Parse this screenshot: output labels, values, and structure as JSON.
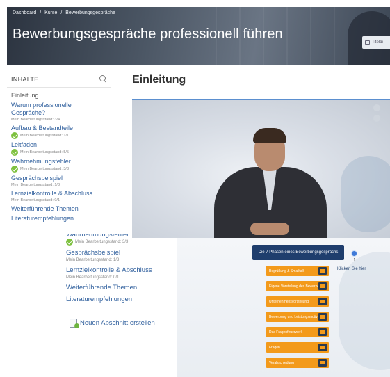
{
  "header": {
    "breadcrumb": [
      "Dashboard",
      "/",
      "Kurse",
      "/",
      "Bewerbungsgespräche"
    ],
    "title": "Bewerbungsgespräche professionell führen",
    "title_chip": "Titelbi"
  },
  "sidebar": {
    "heading": "INHALTE",
    "items": [
      {
        "title": "Einleitung",
        "status": "",
        "done": false
      },
      {
        "title": "Warum professionelle Gespräche?",
        "status": "Mein Bearbeitungsstand: 3/4",
        "done": false
      },
      {
        "title": "Aufbau & Bestandteile",
        "status": "Mein Bearbeitungsstand: 1/1",
        "done": true
      },
      {
        "title": "Leitfaden",
        "status": "Mein Bearbeitungsstand: 5/5",
        "done": true
      },
      {
        "title": "Wahrnehmungsfehler",
        "status": "Mein Bearbeitungsstand: 3/3",
        "done": true
      },
      {
        "title": "Gesprächsbeispiel",
        "status": "Mein Bearbeitungsstand: 1/3",
        "done": false
      },
      {
        "title": "Lernzielkontrolle & Abschluss",
        "status": "Mein Bearbeitungsstand: 0/1",
        "done": false
      },
      {
        "title": "Weiterführende Themen",
        "status": "",
        "done": false
      },
      {
        "title": "Literaturempfehlungen",
        "status": "",
        "done": false
      }
    ]
  },
  "content": {
    "title": "Einleitung"
  },
  "lower": {
    "cut_title": "Wahrnehmungsfehler",
    "items": [
      {
        "title": "",
        "status": "Mein Bearbeitungsstand: 3/3",
        "done": true
      },
      {
        "title": "Gesprächsbeispiel",
        "status": "Mein Bearbeitungsstand: 1/3",
        "done": false
      },
      {
        "title": "Lernzielkontrolle & Abschluss",
        "status": "Mein Bearbeitungsstand: 0/1",
        "done": false
      },
      {
        "title": "Weiterführende Themen",
        "status": "",
        "done": false
      },
      {
        "title": "Literaturempfehlungen",
        "status": "",
        "done": false
      }
    ],
    "new_section": "Neuen Abschnitt erstellen"
  },
  "phases": {
    "header": "Die 7 Phasen eines Bewerbungsgesprächs",
    "hint": "Klicken Sie hier",
    "hint_arrow": "↑",
    "items": [
      "Begrüßung & Smalltalk",
      "Eigene Vorstellung des Bewerbers",
      "Unternehmensvorstellung",
      "Bewerbung und Leistungsmotivation",
      "Das Fragenfeuerwerk",
      "Fragen",
      "Verabschiedung"
    ]
  },
  "colors": {
    "accent": "#2f5f9d",
    "done": "#7ec13f",
    "phase": "#f39a1b",
    "phase_header": "#1f3e6d"
  }
}
